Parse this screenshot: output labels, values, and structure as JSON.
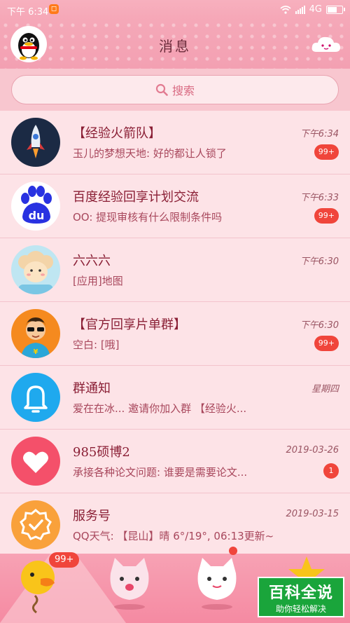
{
  "status_bar": {
    "time": "下午 6:34",
    "network": "4G"
  },
  "header": {
    "title": "消息"
  },
  "search": {
    "placeholder": "搜索"
  },
  "conversations": [
    {
      "name": "【经验火箭队】",
      "message": "玉儿的梦想天地: 好的都让人锁了",
      "time": "下午6:34",
      "badge": "99+"
    },
    {
      "name": "百度经验回享计划交流",
      "message": "OO: 提现审核有什么限制条件吗",
      "time": "下午6:33",
      "badge": "99+"
    },
    {
      "name": "六六六",
      "message": "[应用]地图",
      "time": "下午6:30",
      "badge": ""
    },
    {
      "name": "【官方回享片单群】",
      "message": "空白: [哦]",
      "time": "下午6:30",
      "badge": "99+"
    },
    {
      "name": "群通知",
      "message": "爱在在冰... 邀请你加入群 【经验火...",
      "time": "星期四",
      "badge": ""
    },
    {
      "name": "985硕博2",
      "message": "承接各种论文问题: 谁要是需要论文...",
      "time": "2019-03-26",
      "badge": "1"
    },
    {
      "name": "服务号",
      "message": "QQ天气: 【昆山】晴 6°/19°, 06:13更新~",
      "time": "2019-03-15",
      "badge": ""
    }
  ],
  "bottom_nav": {
    "badge": "99+"
  },
  "watermark": {
    "title": "百科全说",
    "subtitle": "助你轻松解决"
  },
  "colors": {
    "accent": "#f0453b",
    "header_bg": "#f5a8b8",
    "row_bg": "#fde3e7"
  }
}
